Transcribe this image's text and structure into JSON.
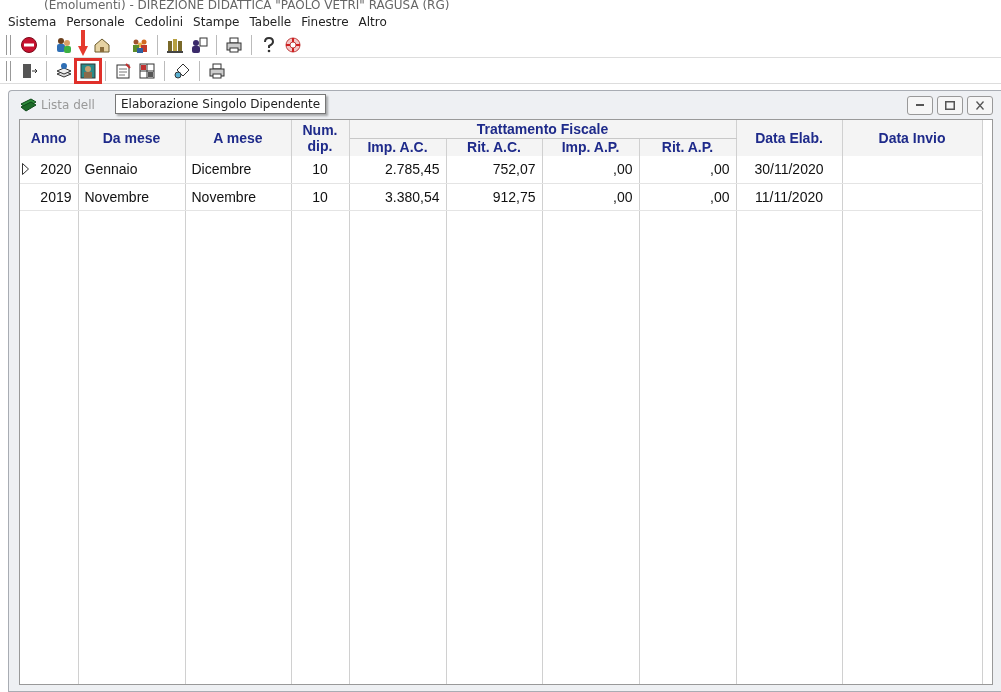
{
  "window": {
    "title": "(Emolumenti) - DIREZIONE DIDATTICA \"PAOLO VETRI\" RAGUSA (RG)"
  },
  "menu": [
    "Sistema",
    "Personale",
    "Cedolini",
    "Stampe",
    "Tabelle",
    "Finestre",
    "Altro"
  ],
  "toolbars": [
    {
      "groups": [
        [
          {
            "kind": "stop",
            "highlighted": false
          }
        ],
        [
          {
            "kind": "people",
            "highlighted": false
          },
          {
            "kind": "house",
            "highlighted": false
          },
          {
            "kind": "crowd",
            "highlighted": false
          }
        ],
        [
          {
            "kind": "books",
            "highlighted": false
          },
          {
            "kind": "person-card",
            "highlighted": false
          }
        ],
        [
          {
            "kind": "printer",
            "highlighted": false
          }
        ],
        [
          {
            "kind": "question",
            "highlighted": false
          },
          {
            "kind": "lifebuoy",
            "highlighted": false
          }
        ]
      ]
    },
    {
      "groups": [
        [
          {
            "kind": "door",
            "highlighted": false
          }
        ],
        [
          {
            "kind": "stack",
            "highlighted": false
          },
          {
            "kind": "portrait",
            "highlighted": true
          }
        ],
        [
          {
            "kind": "notepad",
            "highlighted": false
          },
          {
            "kind": "grid",
            "highlighted": false
          }
        ],
        [
          {
            "kind": "tag",
            "highlighted": false
          }
        ],
        [
          {
            "kind": "printer",
            "highlighted": false
          }
        ]
      ]
    }
  ],
  "tooltip": {
    "text": "Elaborazione Singolo Dipendente"
  },
  "child_window": {
    "title": "Lista dell",
    "table": {
      "group_header": {
        "label": "Trattamento Fiscale"
      },
      "columns": [
        {
          "label": "Anno",
          "grouped": false
        },
        {
          "label": "Da mese",
          "grouped": false
        },
        {
          "label": "A mese",
          "grouped": false
        },
        {
          "label": "Num. dip.",
          "grouped": false
        },
        {
          "label": "Imp. A.C.",
          "grouped": true
        },
        {
          "label": "Rit. A.C.",
          "grouped": true
        },
        {
          "label": "Imp. A.P.",
          "grouped": true
        },
        {
          "label": "Rit. A.P.",
          "grouped": true
        },
        {
          "label": "Data Elab.",
          "grouped": false
        },
        {
          "label": "Data Invio",
          "grouped": false
        }
      ],
      "rows": [
        {
          "current": true,
          "cells": [
            "2020",
            "Gennaio",
            "Dicembre",
            "10",
            "2.785,45",
            "752,07",
            ",00",
            ",00",
            "30/11/2020"
          ]
        },
        {
          "current": false,
          "cells": [
            "2019",
            "Novembre",
            "Novembre",
            "10",
            "3.380,54",
            "912,75",
            ",00",
            ",00",
            "11/11/2020"
          ]
        }
      ]
    }
  }
}
